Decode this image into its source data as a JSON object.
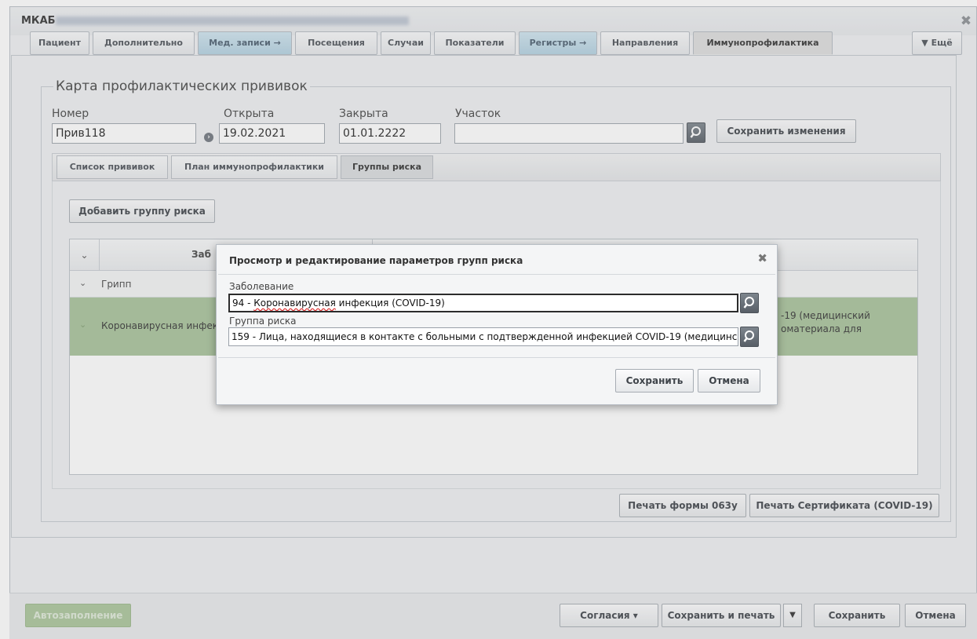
{
  "window": {
    "title": "МКАБ",
    "close_icon": "close-icon"
  },
  "tabs": [
    {
      "label": "Пациент"
    },
    {
      "label": "Дополнительно"
    },
    {
      "label": "Мед. записи →"
    },
    {
      "label": "Посещения"
    },
    {
      "label": "Случаи"
    },
    {
      "label": "Показатели"
    },
    {
      "label": "Регистры →"
    },
    {
      "label": "Направления"
    },
    {
      "label": "Иммунопрофилактика"
    }
  ],
  "more_label": "▼ Ещё",
  "card": {
    "legend": "Карта профилактических прививок",
    "number_label": "Номер",
    "number_value": "Прив118",
    "opened_label": "Открыта",
    "opened_value": "19.02.2021",
    "closed_label": "Закрыта",
    "closed_value": "01.01.2222",
    "district_label": "Участок",
    "district_value": "",
    "save_changes_label": "Сохранить изменения"
  },
  "inner_tabs": [
    {
      "label": "Список прививок"
    },
    {
      "label": "План иммунопрофилактики"
    },
    {
      "label": "Группы риска"
    }
  ],
  "risk": {
    "add_button": "Добавить группу риска",
    "col_disease": "Заб",
    "row_group": "Грипп",
    "row_item": "Коронавирусная инфек",
    "row_item_right": "-19 (медицинский\nоматериала для"
  },
  "print": {
    "form_label": "Печать формы 063у",
    "cert_label": "Печать Сертификата (COVID-19)"
  },
  "modal": {
    "title": "Просмотр и редактирование параметров групп риска",
    "disease_label": "Заболевание",
    "disease_code": "94 - ",
    "disease_word": "Коронавирусная",
    "disease_rest": " инфекция (COVID-19)",
    "group_label": "Группа риска",
    "group_value": "159 - Лица, находящиеся в контакте с больными с подтвержденной инфекцией COVID-19 (медицинск",
    "save_label": "Сохранить",
    "cancel_label": "Отмена"
  },
  "bottom": {
    "autofill_label": "Автозаполнение",
    "consent_label": "Согласия  ▾",
    "save_print_label": "Сохранить и печать",
    "save_label": "Сохранить",
    "cancel_label": "Отмена"
  }
}
